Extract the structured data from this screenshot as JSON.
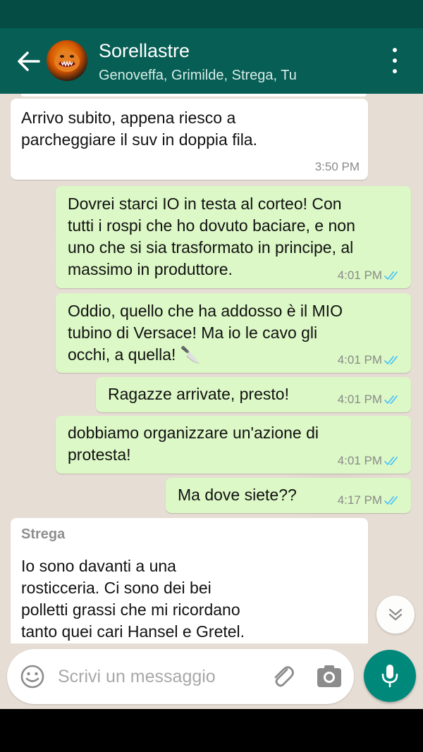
{
  "header": {
    "title": "Sorellastre",
    "subtitle": "Genoveffa, Grimilde, Strega, Tu"
  },
  "messages": [
    {
      "direction": "in",
      "text": "Arrivo subito, appena riesco a\nparcheggiare il suv in doppia fila.",
      "time": "3:50 PM"
    },
    {
      "direction": "out",
      "text": "Dovrei starci IO in testa al corteo! Con\ntutti i rospi che ho dovuto baciare, e non\nuno che si sia trasformato in principe, al\nmassimo in produttore.",
      "time": "4:01 PM",
      "status": "read"
    },
    {
      "direction": "out",
      "text": "Oddio, quello che ha addosso è il MIO\ntubino di Versace! Ma io le cavo gli\nocchi, a quella! 🔪",
      "time": "4:01 PM",
      "status": "read"
    },
    {
      "direction": "out",
      "text": "Ragazze arrivate, presto!",
      "time": "4:01 PM",
      "status": "read"
    },
    {
      "direction": "out",
      "text": "dobbiamo organizzare un'azione di\nprotesta!",
      "time": "4:01 PM",
      "status": "read"
    },
    {
      "direction": "out",
      "text": "Ma dove siete??",
      "time": "4:17 PM",
      "status": "read"
    },
    {
      "direction": "in",
      "sender": "Strega",
      "text": "Io sono davanti a una\nrosticceria.  Ci sono dei bei\npolletti grassi che mi ricordano\ntanto quei cari Hansel e Gretel."
    }
  ],
  "composer": {
    "placeholder": "Scrivi un messaggio",
    "value": ""
  },
  "colors": {
    "header": "#075e54",
    "status_bar": "#054d44",
    "outgoing_bubble": "#dcf8c6",
    "incoming_bubble": "#ffffff",
    "read_ticks": "#4fc3f7",
    "mic_button": "#00897b"
  },
  "icons": {
    "back": "arrow-left-icon",
    "menu": "more-vert-icon",
    "read_status": "double-check-icon",
    "scroll": "chevron-double-down-icon",
    "emoji": "smiley-icon",
    "attach": "paperclip-icon",
    "camera": "camera-icon",
    "mic": "microphone-icon"
  }
}
